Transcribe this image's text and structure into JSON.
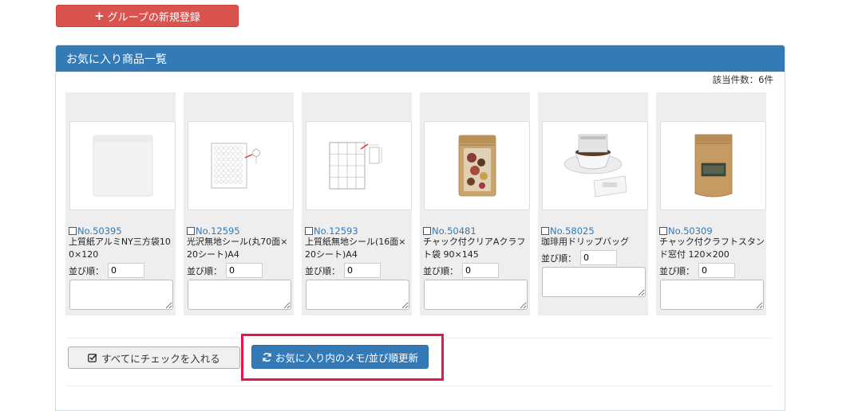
{
  "header": {
    "new_group_label": "グループの新規登録"
  },
  "panel": {
    "title": "お気に入り商品一覧",
    "count_text": "該当件数：6件"
  },
  "sort_label": "並び順：",
  "items": [
    {
      "no": "No.50395",
      "name": "上質紙アルミNY三方袋100×120",
      "sort": "0"
    },
    {
      "no": "No.12595",
      "name": "光沢無地シール(丸70面×20シート)A4",
      "sort": "0"
    },
    {
      "no": "No.12593",
      "name": "上質紙無地シール(16面×20シート)A4",
      "sort": "0"
    },
    {
      "no": "No.50481",
      "name": "チャック付クリアAクラフト袋 90×145",
      "sort": "0"
    },
    {
      "no": "No.58025",
      "name": "珈琲用ドリップバッグ",
      "sort": "0"
    },
    {
      "no": "No.50309",
      "name": "チャック付クラフトスタンド窓付 120×200",
      "sort": "0"
    }
  ],
  "actions": {
    "check_all_label": "すべてにチェックを入れる",
    "update_label": "お気に入り内のメモ/並び順更新"
  },
  "colors": {
    "danger": "#d9534f",
    "primary": "#337ab7",
    "highlight": "#e8174b"
  }
}
